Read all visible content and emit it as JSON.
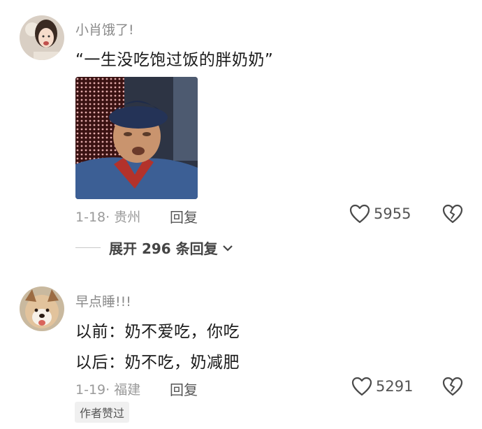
{
  "comments": [
    {
      "username": "小肖饿了!",
      "text_lines": [
        "“一生没吃饱过饭的胖奶奶”"
      ],
      "meta": "1-18· 贵州",
      "reply_label": "回复",
      "like_count": "5955",
      "expand_label": "展开 296 条回复"
    },
    {
      "username": "早点睡!!!",
      "text_lines": [
        "以前：奶不爱吃，你吃",
        "以后：奶不吃，奶减肥"
      ],
      "meta": "1-19· 福建",
      "reply_label": "回复",
      "like_count": "5291",
      "badge": "作者赞过"
    }
  ],
  "icons": {
    "like": "heart-outline-icon",
    "dislike": "broken-heart-icon",
    "expand": "chevron-down-icon"
  }
}
